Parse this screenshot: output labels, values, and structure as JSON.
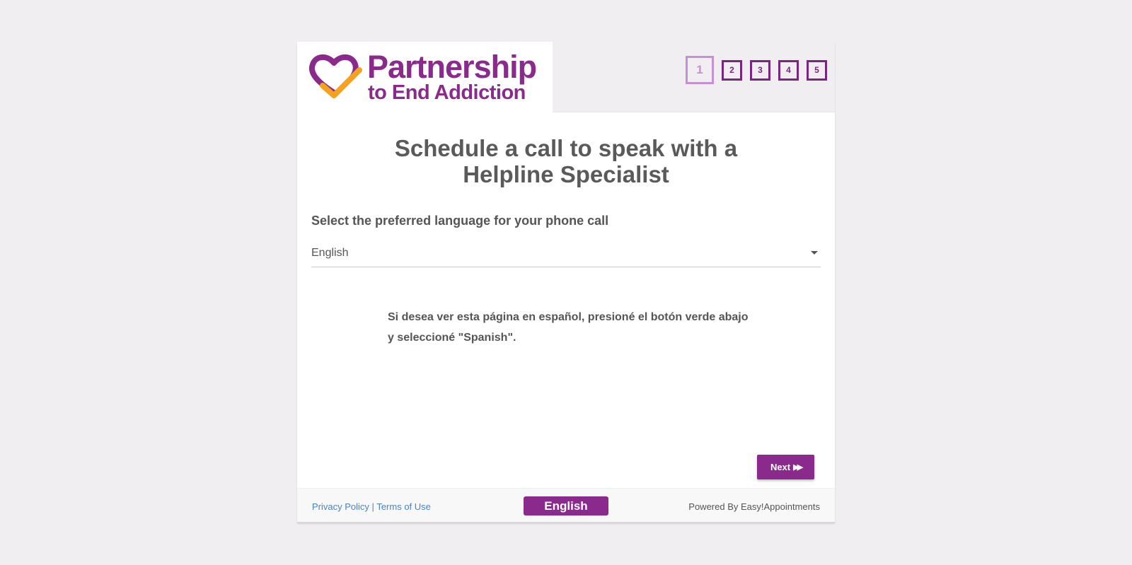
{
  "header": {
    "logo_line1": "Partnership",
    "logo_line2": "to End Addiction",
    "steps": [
      "1",
      "2",
      "3",
      "4",
      "5"
    ],
    "active_step": 1
  },
  "main": {
    "title": "Schedule a call to speak with a Helpline Specialist",
    "language_label": "Select the preferred language for your phone call",
    "language_select": {
      "selected": "English"
    },
    "spanish_notice": "Si desea ver esta página en español, presioné el botón verde abajo y seleccioné \"Spanish\".",
    "next_label": "Next"
  },
  "footer": {
    "privacy_label": "Privacy Policy",
    "separator": "|",
    "terms_label": "Terms of Use",
    "language_button": "English",
    "powered_by": "Powered By Easy!Appointments"
  },
  "colors": {
    "brand_purple": "#8a2a8c",
    "logo_orange": "#f7a21b",
    "step_active": "#c690d6",
    "link_blue": "#4a84c0",
    "page_bg": "#f0eef0"
  }
}
